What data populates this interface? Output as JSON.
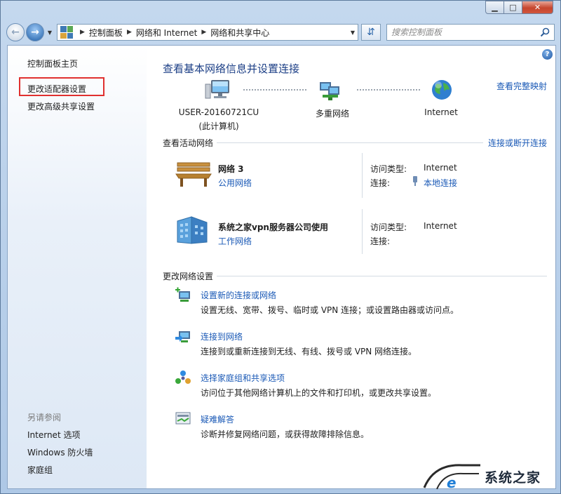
{
  "titlebar": {
    "minimize": "▁",
    "maximize": "□",
    "close": "✕"
  },
  "nav": {
    "breadcrumbs": [
      "控制面板",
      "网络和 Internet",
      "网络和共享中心"
    ],
    "search_placeholder": "搜索控制面板"
  },
  "sidebar": {
    "items": [
      {
        "label": "控制面板主页"
      },
      {
        "label": "更改适配器设置"
      },
      {
        "label": "更改高级共享设置"
      }
    ],
    "see_also_header": "另请参阅",
    "see_also": [
      {
        "label": "Internet 选项"
      },
      {
        "label": "Windows 防火墙"
      },
      {
        "label": "家庭组"
      }
    ]
  },
  "main": {
    "help": "?",
    "title": "查看基本网络信息并设置连接",
    "view_full_map": "查看完整映射",
    "map": {
      "computer_line1": "USER-20160721CU",
      "computer_line2": "(此计算机)",
      "network": "多重网络",
      "internet": "Internet"
    },
    "active_header": "查看活动网络",
    "connect_disconnect": "连接或断开连接",
    "networks": [
      {
        "name": "网络  3",
        "type": "公用网络",
        "access_label": "访问类型:",
        "access_value": "Internet",
        "conn_label": "连接:",
        "conn_value": "本地连接"
      },
      {
        "name": "系统之家vpn服务器公司使用",
        "type": "工作网络",
        "access_label": "访问类型:",
        "access_value": "Internet",
        "conn_label": "连接:",
        "conn_value": ""
      }
    ],
    "change_header": "更改网络设置",
    "tasks": [
      {
        "title": "设置新的连接或网络",
        "desc": "设置无线、宽带、拨号、临时或 VPN 连接；或设置路由器或访问点。"
      },
      {
        "title": "连接到网络",
        "desc": "连接到或重新连接到无线、有线、拨号或 VPN 网络连接。"
      },
      {
        "title": "选择家庭组和共享选项",
        "desc": "访问位于其他网络计算机上的文件和打印机，或更改共享设置。"
      },
      {
        "title": "疑难解答",
        "desc": "诊断并修复网络问题，或获得故障排除信息。"
      }
    ]
  },
  "watermark": {
    "text": "系统之家"
  }
}
